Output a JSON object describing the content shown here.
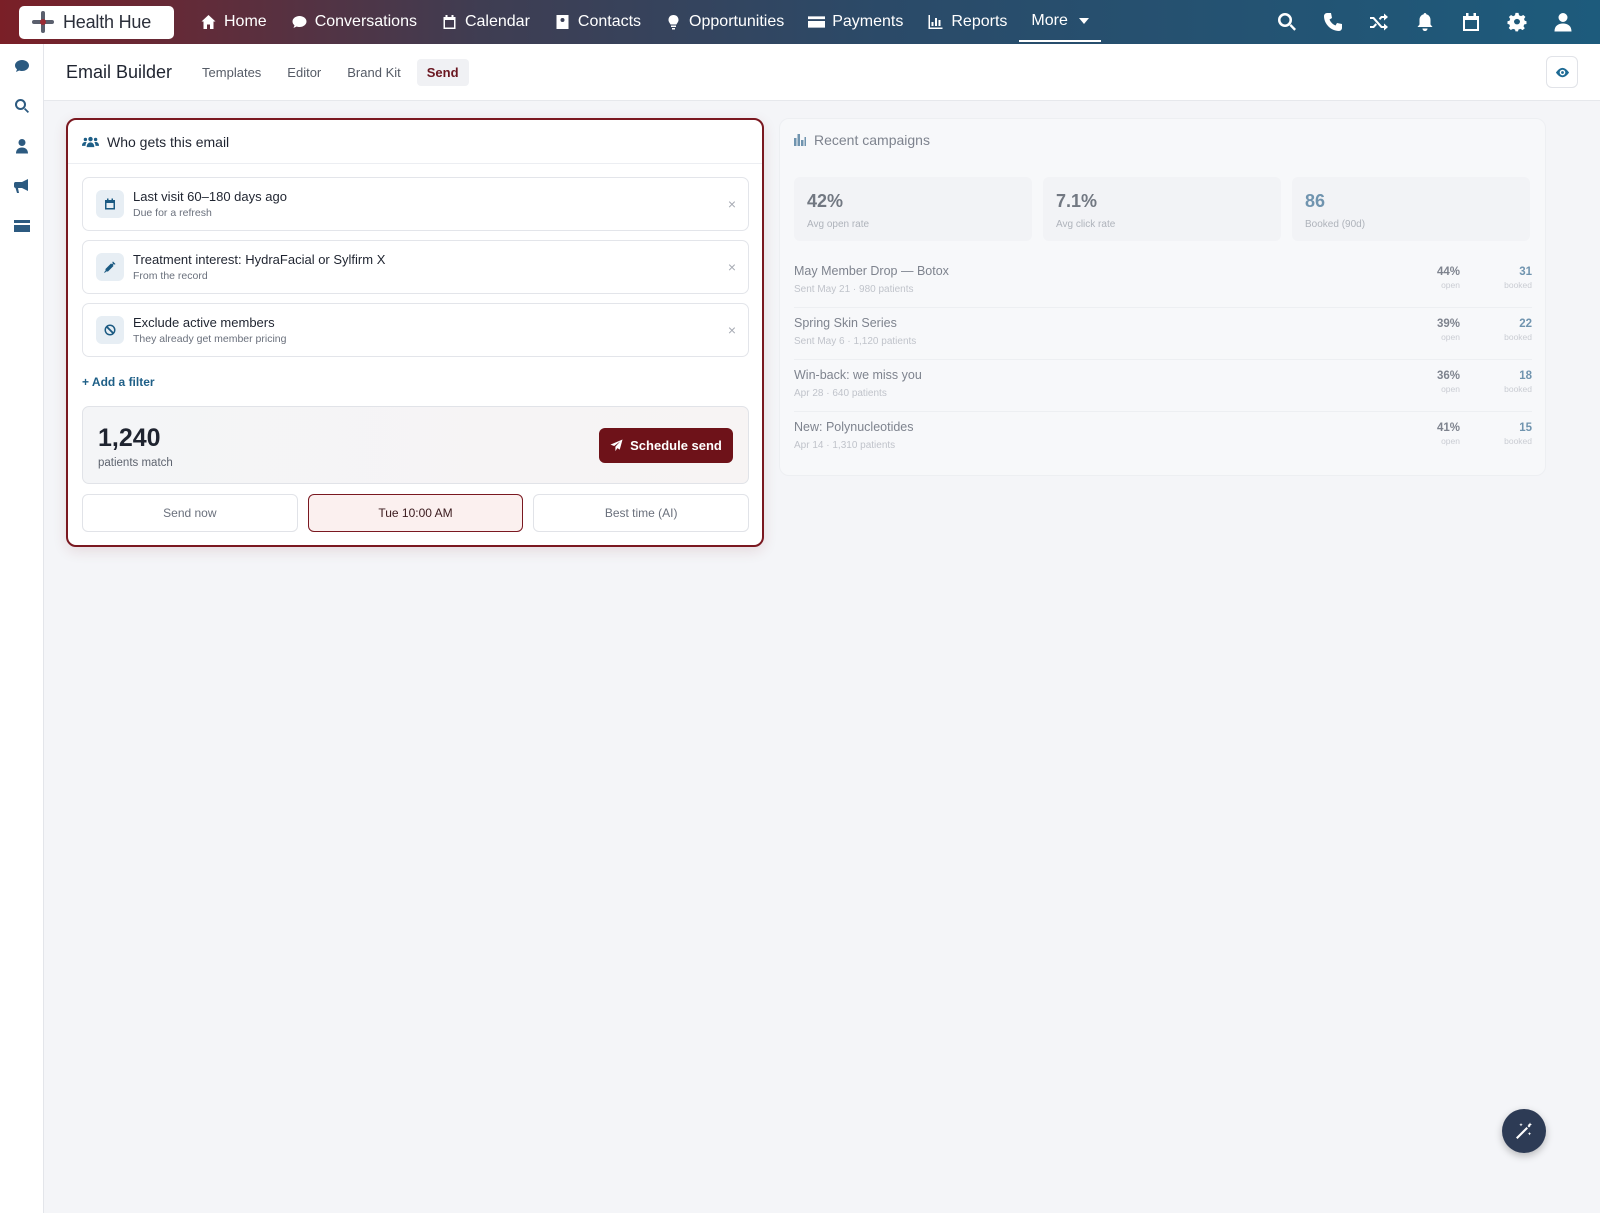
{
  "app": {
    "brand": "Health Hue",
    "nav": [
      {
        "label": "Home",
        "icon": "home-icon"
      },
      {
        "label": "Conversations",
        "icon": "chat-icon"
      },
      {
        "label": "Calendar",
        "icon": "calendar-icon"
      },
      {
        "label": "Contacts",
        "icon": "contacts-icon"
      },
      {
        "label": "Opportunities",
        "icon": "lightbulb-icon"
      },
      {
        "label": "Payments",
        "icon": "credit-card-icon"
      },
      {
        "label": "Reports",
        "icon": "bar-chart-icon"
      },
      {
        "label": "More",
        "icon": "chevron-down-icon"
      }
    ],
    "right_icons": [
      "search-icon",
      "phone-icon",
      "shuffle-icon",
      "bell-icon",
      "calendar-icon",
      "gear-icon",
      "user-icon"
    ],
    "rail_icons": [
      "chat-icon",
      "search-icon",
      "user-icon",
      "megaphone-icon",
      "credit-card-icon"
    ],
    "colors": {
      "primary": "#6e1219",
      "accent": "#1e5f87"
    }
  },
  "subheader": {
    "title": "Email Builder",
    "tabs": [
      "Templates",
      "Editor",
      "Brand Kit",
      "Send"
    ],
    "active_tab": "Send"
  },
  "audience": {
    "title": "Who gets this email",
    "filters": [
      {
        "label": "Last visit 60–180 days ago",
        "sub": "Due for a refresh",
        "icon": "calendar-icon"
      },
      {
        "label": "Treatment interest: HydraFacial or Sylfirm X",
        "sub": "From the record",
        "icon": "syringe-icon"
      },
      {
        "label": "Exclude active members",
        "sub": "They already get member pricing",
        "icon": "ban-icon"
      }
    ],
    "add_filter": "+ Add a filter",
    "match_count": "1,240",
    "match_label": "patients match",
    "schedule_button": "Schedule send",
    "time_options": [
      "Send now",
      "Tue 10:00 AM",
      "Best time (AI)"
    ],
    "selected_time": "Tue 10:00 AM"
  },
  "recent": {
    "title": "Recent campaigns",
    "stats": [
      {
        "value": "42%",
        "label": "Avg open rate"
      },
      {
        "value": "7.1%",
        "label": "Avg click rate"
      },
      {
        "value": "86",
        "label": "Booked (90d)"
      }
    ],
    "campaigns": [
      {
        "name": "May Member Drop — Botox",
        "meta": "Sent May 21 · 980 patients",
        "open": "44%",
        "open_label": "open",
        "booked": "31",
        "booked_label": "booked"
      },
      {
        "name": "Spring Skin Series",
        "meta": "Sent May 6 · 1,120 patients",
        "open": "39%",
        "open_label": "open",
        "booked": "22",
        "booked_label": "booked"
      },
      {
        "name": "Win-back: we miss you",
        "meta": "Apr 28 · 640 patients",
        "open": "36%",
        "open_label": "open",
        "booked": "18",
        "booked_label": "booked"
      },
      {
        "name": "New: Polynucleotides",
        "meta": "Apr 14 · 1,310 patients",
        "open": "41%",
        "open_label": "open",
        "booked": "15",
        "booked_label": "booked"
      }
    ]
  }
}
